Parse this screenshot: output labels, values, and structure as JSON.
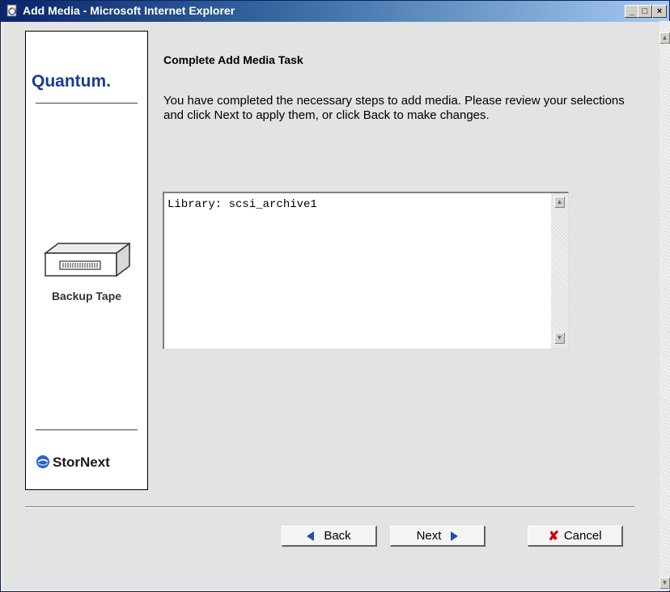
{
  "window": {
    "title": "Add Media - Microsoft Internet Explorer",
    "min_glyph": "_",
    "max_glyph": "□",
    "close_glyph": "×"
  },
  "branding": {
    "logo_text": "Quantum.",
    "product_label": "Backup Tape",
    "footer_brand": "StorNext",
    "logo_color": "#1a3e8c"
  },
  "main": {
    "heading": "Complete Add Media Task",
    "description": "You have completed the necessary steps to add media. Please review your selections and click Next to apply them, or click Back to make changes.",
    "summary_text": "Library: scsi_archive1"
  },
  "buttons": {
    "back_label": "Back",
    "next_label": "Next",
    "cancel_label": "Cancel"
  },
  "icons": {
    "title": "ie-page-icon",
    "tape": "tape-drive-icon",
    "stornext": "stornext-logo-icon",
    "back": "arrow-left-icon",
    "next": "arrow-right-icon",
    "cancel": "x-icon"
  },
  "colors": {
    "titlebar_start": "#0a246a",
    "arrow_blue": "#1f4fa8",
    "cancel_red": "#cc0000"
  }
}
